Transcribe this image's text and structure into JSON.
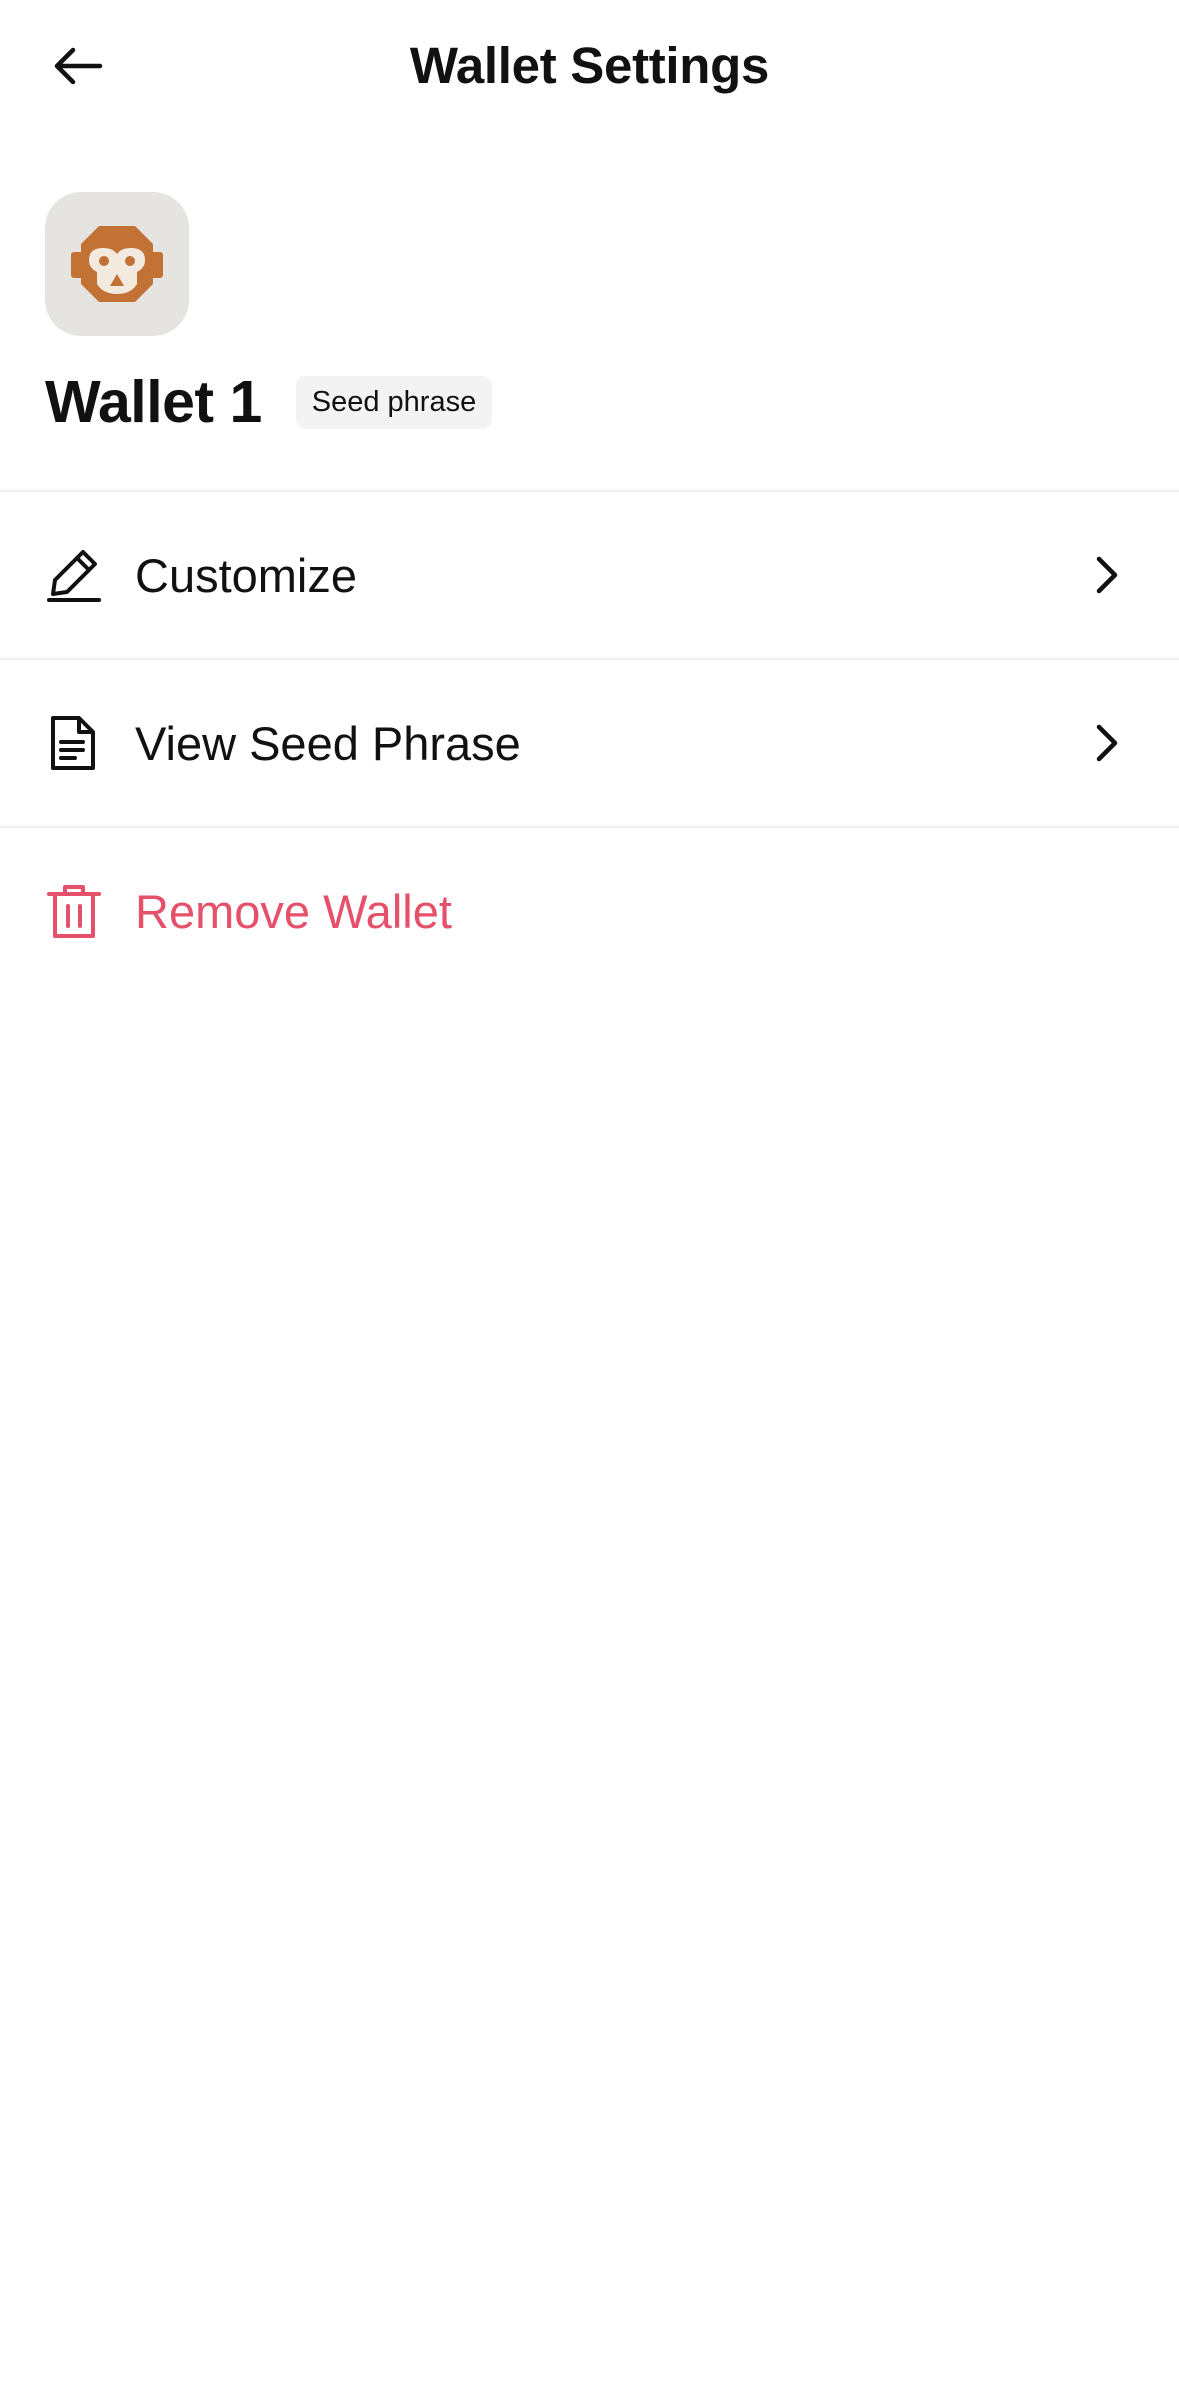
{
  "header": {
    "title": "Wallet Settings",
    "back_icon": "arrow-left-icon"
  },
  "wallet": {
    "name": "Wallet 1",
    "badge": "Seed phrase",
    "avatar_icon": "monkey-face-icon",
    "avatar_color": "#c27234",
    "avatar_bg": "#e6e4e1"
  },
  "menu": {
    "customize": {
      "label": "Customize",
      "icon": "pencil-icon"
    },
    "view_seed": {
      "label": "View Seed Phrase",
      "icon": "document-icon"
    },
    "remove": {
      "label": "Remove Wallet",
      "icon": "trash-icon",
      "color": "#e5506a"
    }
  }
}
